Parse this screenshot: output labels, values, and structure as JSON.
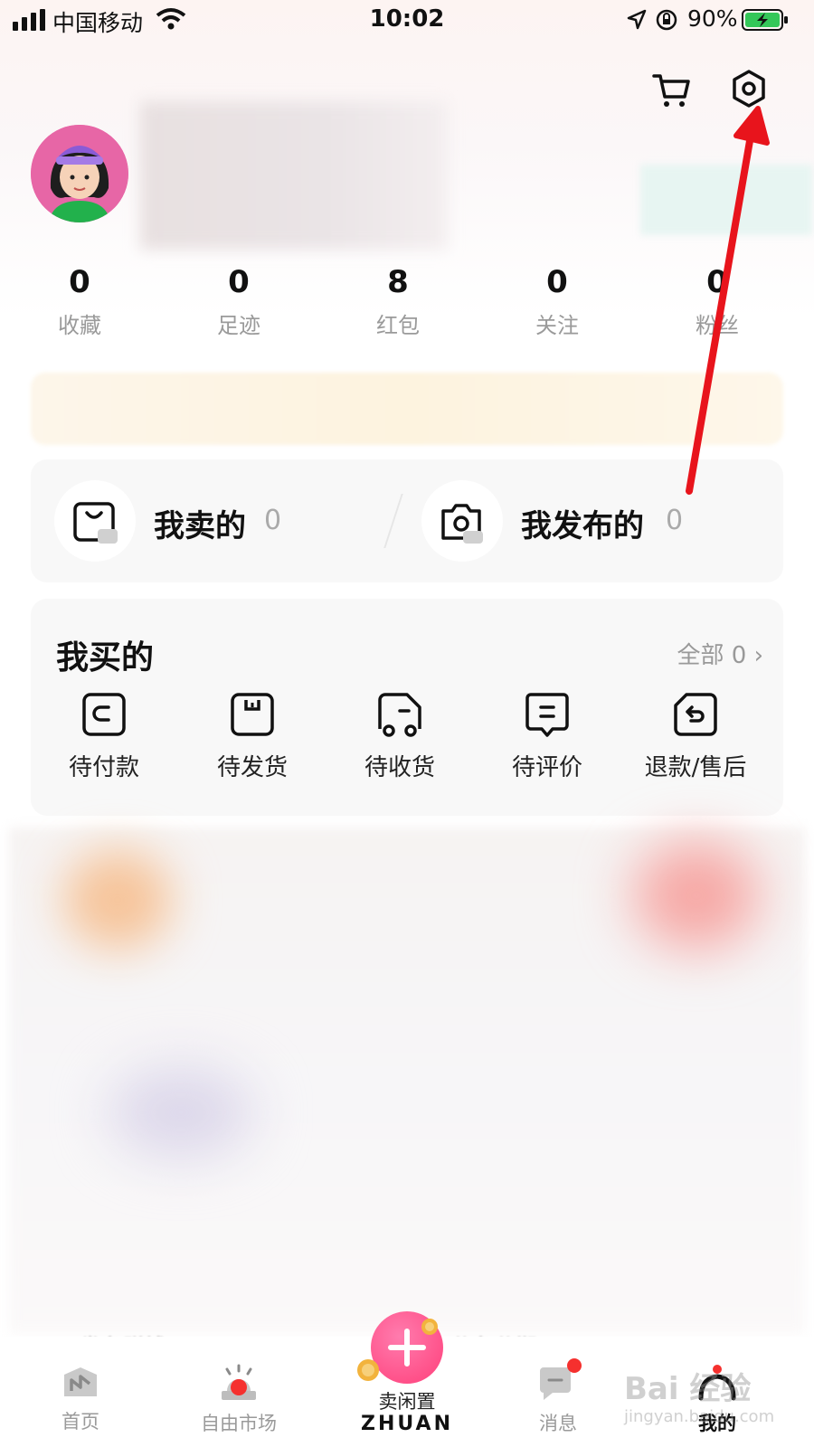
{
  "status_bar": {
    "carrier": "中国移动",
    "time": "10:02",
    "battery": "90%"
  },
  "stats": [
    {
      "value": "0",
      "label": "收藏"
    },
    {
      "value": "0",
      "label": "足迹"
    },
    {
      "value": "8",
      "label": "红包"
    },
    {
      "value": "0",
      "label": "关注"
    },
    {
      "value": "0",
      "label": "粉丝"
    }
  ],
  "sell_section": {
    "sold": {
      "label": "我卖的",
      "count": "0"
    },
    "published": {
      "label": "我发布的",
      "count": "0"
    }
  },
  "buy_section": {
    "title": "我买的",
    "all_label": "全部",
    "all_count": "0",
    "items": [
      {
        "label": "待付款",
        "icon": "wallet-icon"
      },
      {
        "label": "待发货",
        "icon": "box-icon"
      },
      {
        "label": "待收货",
        "icon": "truck-icon"
      },
      {
        "label": "待评价",
        "icon": "comment-icon"
      },
      {
        "label": "退款/售后",
        "icon": "refund-icon"
      }
    ]
  },
  "partial_text": {
    "left": "发条赚钱",
    "right": "分条分期"
  },
  "tab_bar": {
    "tabs": [
      {
        "label": "首页",
        "icon": "home-icon"
      },
      {
        "label": "自由市场",
        "icon": "market-icon"
      },
      {
        "label": "卖闲置",
        "icon": "plus-icon"
      },
      {
        "label": "消息",
        "icon": "message-icon"
      },
      {
        "label": "我的",
        "icon": "profile-icon"
      }
    ],
    "center_sub": "ZHUAN",
    "active": "我的"
  },
  "watermark": {
    "line1": "Bai 经验",
    "line2": "jingyan.baidu.com"
  },
  "colors": {
    "annotation_arrow": "#e8141c",
    "accent_pink": "#ff3f7a",
    "badge_red": "#f5302e"
  }
}
